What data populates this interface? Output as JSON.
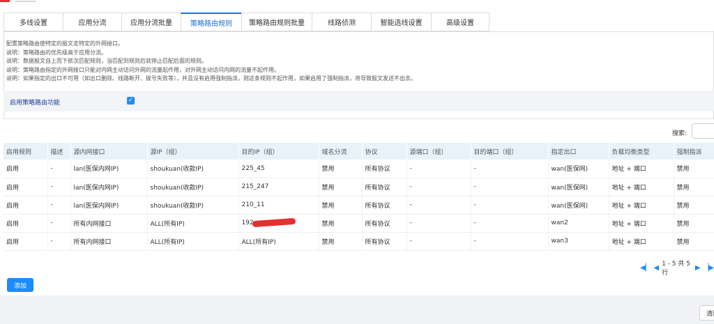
{
  "tabs": [
    {
      "label": "多线设置"
    },
    {
      "label": "应用分流"
    },
    {
      "label": "应用分流批量"
    },
    {
      "label": "策略路由规则",
      "active": true
    },
    {
      "label": "策略路由规则批量"
    },
    {
      "label": "线路侦测"
    },
    {
      "label": "智能选线设置"
    },
    {
      "label": "高级设置"
    }
  ],
  "notes": [
    "配置策略路由使特定的报文走特定的外网接口。",
    "说明：策略路由的优先级高于应用分流。",
    "说明：数据报文自上而下依次匹配规则，当匹配到规则后就停止匹配后面的规则。",
    "说明：策略路由指定的外网接口只能对内网主动访问外网的流量起作用，对外网主动访问内网的流量不起作用。",
    "说明：如果指定的出口不可用（如出口删除、线路断开、拨号失败等），并且没有启用强制指派，则这条规则不起作用，如果启用了强制指派，将导致报文发送不出去。"
  ],
  "enable": {
    "label": "启用策略路由功能",
    "checked": true
  },
  "search": {
    "label": "搜索:"
  },
  "table": {
    "headers": [
      "启用规则",
      "描述",
      "源内网接口",
      "源IP（组）",
      "目的IP（组）",
      "域名分流",
      "协议",
      "源端口（组）",
      "目的端口（组）",
      "指定出口",
      "负载均衡类型",
      "强制指派"
    ],
    "rows": [
      [
        "启用",
        "-",
        "lan(医保内网IP)",
        "shoukuan(收款IP)",
        "225_45",
        "禁用",
        "所有协议",
        "-",
        "-",
        "wan(医保网)",
        "地址 + 端口",
        "禁用"
      ],
      [
        "启用",
        "-",
        "lan(医保内网IP)",
        "shoukuan(收款IP)",
        "215_247",
        "禁用",
        "所有协议",
        "-",
        "-",
        "wan(医保网)",
        "地址 + 端口",
        "禁用"
      ],
      [
        "启用",
        "-",
        "lan(医保内网IP)",
        "shoukuan(收款IP)",
        "210_11",
        "禁用",
        "所有协议",
        "-",
        "-",
        "wan(医保网)",
        "地址 + 端口",
        "禁用"
      ],
      [
        "启用",
        "-",
        "所有内网接口",
        "ALL(所有IP)",
        "192",
        "禁用",
        "所有协议",
        "-",
        "-",
        "wan2",
        "地址 + 端口",
        "禁用"
      ],
      [
        "启用",
        "-",
        "所有内网接口",
        "ALL(所有IP)",
        "ALL(所有IP)",
        "禁用",
        "所有协议",
        "-",
        "-",
        "wan3",
        "地址 + 端口",
        "禁用"
      ]
    ]
  },
  "pager": {
    "text": "1 - 5 共 5 行"
  },
  "add_button": {
    "label": "添加"
  },
  "bottom_button": {
    "label": "清除"
  },
  "colors": {
    "accent": "#1a8cff",
    "header_bg": "#e9f2f9",
    "redaction": "#e53030"
  },
  "icons": [
    "first-page-icon",
    "prev-page-icon",
    "next-page-icon",
    "last-page-icon",
    "checkmark-icon"
  ]
}
